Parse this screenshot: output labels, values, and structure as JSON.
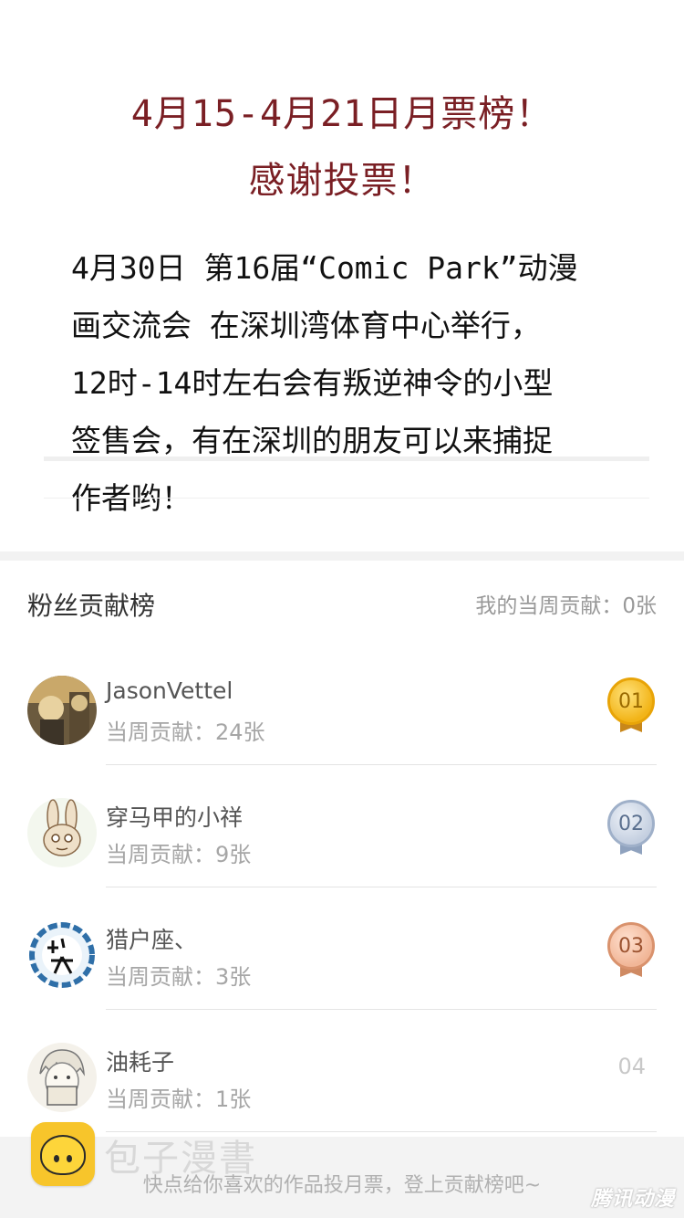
{
  "notice": {
    "title_line1": "4月15-4月21日月票榜！",
    "title_line2": "感谢投票！",
    "body_lines": [
      "4月30日 第16届“Comic Park”动漫",
      "画交流会 在深圳湾体育中心举行，",
      "12时-14时左右会有叛逆神令的小型",
      "签售会，有在深圳的朋友可以来捕捉",
      "作者哟！"
    ]
  },
  "fans": {
    "title": "粉丝贡献榜",
    "my_contribution": "我的当周贡献：0张",
    "rows": [
      {
        "name": "JasonVettel",
        "contribution": "当周贡献：24张",
        "rank": "01",
        "medal": "gold"
      },
      {
        "name": "穿马甲的小祥",
        "contribution": "当周贡献：9张",
        "rank": "02",
        "medal": "silver"
      },
      {
        "name": "猎户座、",
        "contribution": "当周贡献：3张",
        "rank": "03",
        "medal": "bronze"
      },
      {
        "name": "油耗子",
        "contribution": "当周贡献：1张",
        "rank": "04",
        "medal": "none"
      }
    ]
  },
  "footer": {
    "hint": "快点给你喜欢的作品投月票，登上贡献榜吧~",
    "brand": "包子漫書",
    "watermark": "腾讯动漫"
  },
  "colors": {
    "notice_title": "#7a1f24",
    "gold": "#f2b418",
    "silver": "#c4cfe0",
    "bronze": "#f1b697"
  }
}
